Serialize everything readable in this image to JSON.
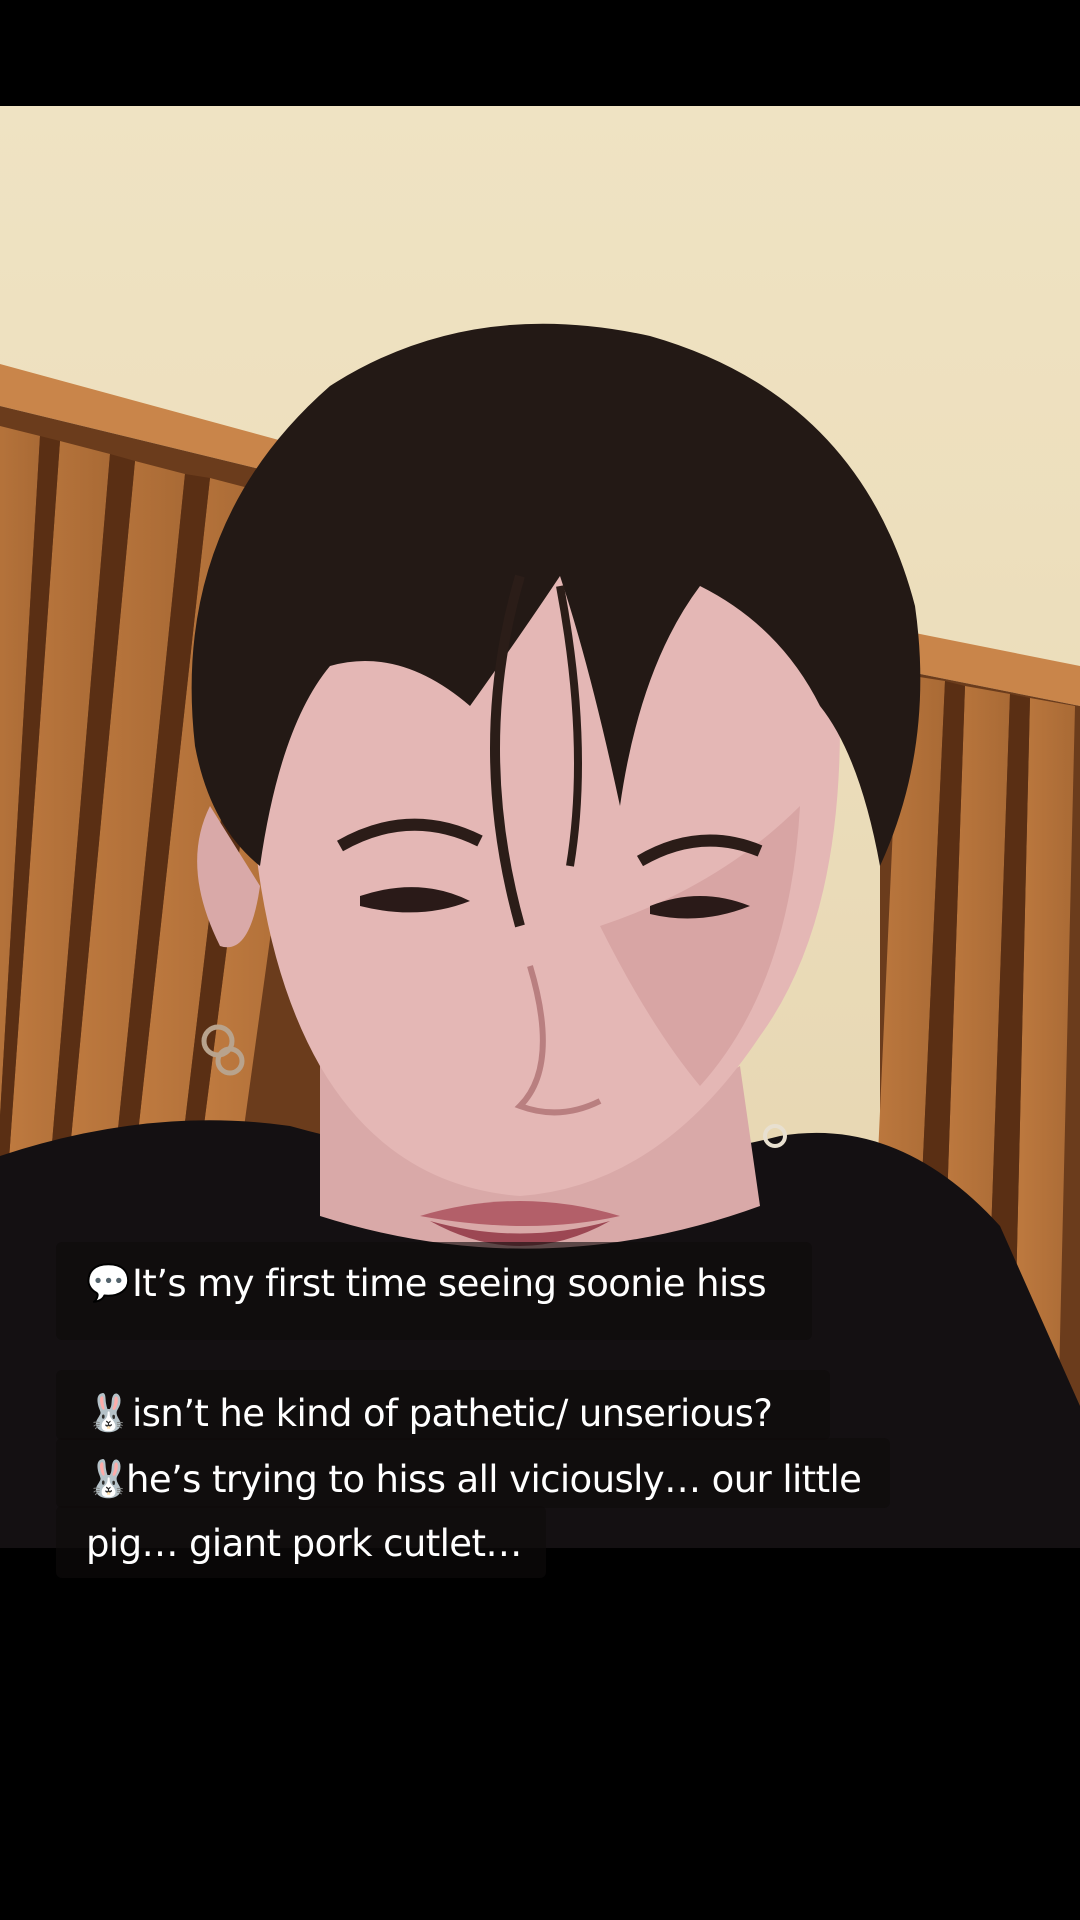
{
  "captions": {
    "line1": {
      "icon": "speech-bubble-icon",
      "text": "It’s my first time seeing soonie hiss"
    },
    "line2": {
      "icon": "rabbit-face-icon",
      "text": "isn’t he kind of pathetic/ unserious?"
    },
    "line3": {
      "icon": "rabbit-face-icon",
      "text": "he’s trying to hiss all viciously… our little"
    },
    "line4": {
      "text": "pig… giant pork cutlet…"
    }
  },
  "colors": {
    "background": "#000000",
    "caption_box": "#0f0c0c",
    "caption_text": "#ffffff",
    "wall": "#eddfbd",
    "wood": "#b0713c"
  }
}
